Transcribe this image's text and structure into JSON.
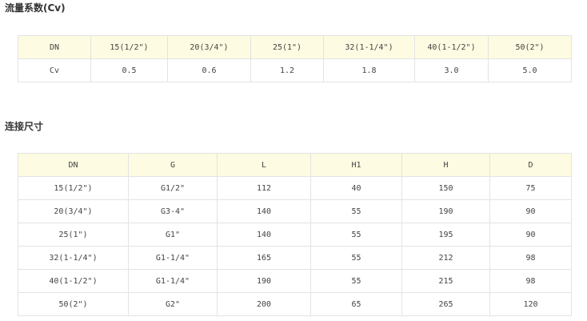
{
  "flow": {
    "heading": "流量系数(Cv)",
    "header": [
      "DN",
      "15(1/2\")",
      "20(3/4\")",
      "25(1\")",
      "32(1-1/4\")",
      "40(1-1/2\")",
      "50(2\")"
    ],
    "row": [
      "Cv",
      "0.5",
      "0.6",
      "1.2",
      "1.8",
      "3.0",
      "5.0"
    ]
  },
  "connection": {
    "heading": "连接尺寸",
    "header": [
      "DN",
      "G",
      "L",
      "H1",
      "H",
      "D"
    ],
    "rows": [
      [
        "15(1/2\")",
        "G1/2\"",
        "112",
        "40",
        "150",
        "75"
      ],
      [
        "20(3/4\")",
        "G3-4\"",
        "140",
        "55",
        "190",
        "90"
      ],
      [
        "25(1\")",
        "G1\"",
        "140",
        "55",
        "195",
        "90"
      ],
      [
        "32(1-1/4\")",
        "G1-1/4\"",
        "165",
        "55",
        "212",
        "98"
      ],
      [
        "40(1-1/2\")",
        "G1-1/4\"",
        "190",
        "55",
        "215",
        "98"
      ],
      [
        "50(2\")",
        "G2\"",
        "200",
        "65",
        "265",
        "120"
      ]
    ]
  },
  "colors": {
    "header_bg": "#fdfbe1",
    "border": "#e3e3e3",
    "text": "#444444"
  }
}
